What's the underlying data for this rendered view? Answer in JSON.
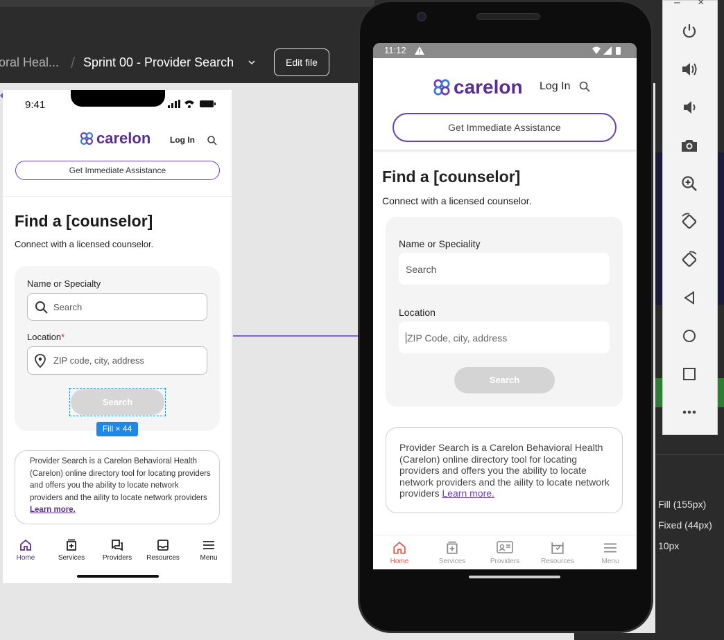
{
  "figma": {
    "breadcrumb_prev": "oral Heal...",
    "breadcrumb_sep": "/",
    "file_title": "Sprint 00 - Provider Search",
    "edit_button": "Edit file",
    "selection_badge": "Fill × 44",
    "mock": {
      "status_time": "9:41",
      "brand": "carelon",
      "login": "Log In",
      "assist_button": "Get Immediate Assistance",
      "heading": "Find a [counselor]",
      "subheading": "Connect with a licensed counselor.",
      "name_label": "Name or Specialty",
      "name_placeholder": "Search",
      "location_label": "Location",
      "location_required": "*",
      "location_placeholder": "ZIP code, city, address",
      "search_button": "Search",
      "info_text": "Provider Search is a Carelon Behavioral Health (Carelon) online directory tool for locating providers and offers you the ability to locate network providers and the aility to locate network providers ",
      "info_link": "Learn more.",
      "nav": [
        {
          "label": "Home",
          "icon": "home-icon"
        },
        {
          "label": "Services",
          "icon": "services-icon"
        },
        {
          "label": "Providers",
          "icon": "providers-icon"
        },
        {
          "label": "Resources",
          "icon": "resources-icon"
        },
        {
          "label": "Menu",
          "icon": "menu-icon"
        }
      ]
    }
  },
  "emulator": {
    "status_time": "11:12",
    "brand": "carelon",
    "login": "Log In",
    "assist_button": "Get Immediate Assistance",
    "heading": "Find a [counselor]",
    "subheading": "Connect with a licensed counselor.",
    "name_label": "Name or Speciality",
    "name_placeholder": "Search",
    "location_label": "Location",
    "location_placeholder": "ZIP Code, city, address",
    "search_button": "Search",
    "info_text": "Provider Search is a Carelon Behavioral Health (Carelon) online directory tool for locating providers and offers you the ability to locate network providers and the aility to locate network providers ",
    "info_link": "Learn more.",
    "nav": [
      {
        "label": "Home",
        "icon": "home-icon"
      },
      {
        "label": "Services",
        "icon": "services-icon"
      },
      {
        "label": "Providers",
        "icon": "providers-icon"
      },
      {
        "label": "Resources",
        "icon": "resources-icon"
      },
      {
        "label": "Menu",
        "icon": "menu-icon"
      }
    ]
  },
  "emulator_controls": {
    "minimize": "–",
    "close": "×",
    "buttons": [
      "power-icon",
      "volume-up-icon",
      "volume-down-icon",
      "camera-icon",
      "zoom-in-icon",
      "rotate-left-icon",
      "rotate-right-icon",
      "back-icon",
      "home-circle-icon",
      "overview-icon",
      "more-icon"
    ]
  },
  "right_panel": {
    "fill_text": "Fill (155px)",
    "fixed_text": "Fixed (44px)",
    "gap_text": "10px"
  },
  "colors": {
    "brand_purple": "#5a2d91",
    "emulator_active_nav": "#e05a4a",
    "figma_selection": "#1e88e5"
  }
}
